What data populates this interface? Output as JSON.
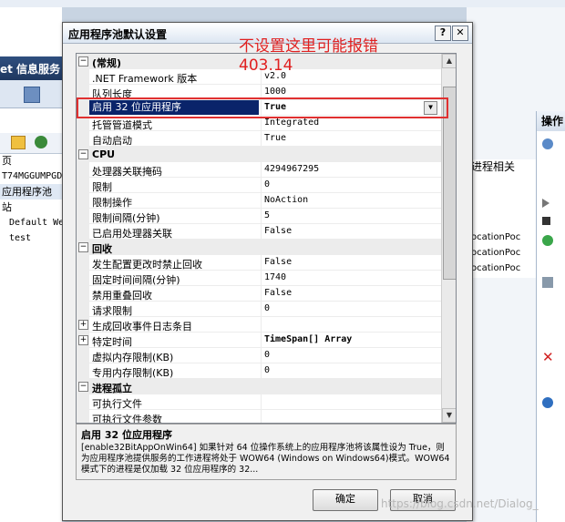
{
  "background": {
    "header_title": "et 信息服务",
    "tree": [
      "页",
      "T74MGGUMPGD",
      "应用程序池",
      "站",
      "Default We",
      "test"
    ],
    "right_middle": [
      "进程相关",
      "ocationPoc",
      "ocationPoc",
      "ocationPoc"
    ],
    "actions_header": "操作"
  },
  "dialog": {
    "title": "应用程序池默认设置",
    "help_button": "?",
    "close_button": "✕",
    "ok_label": "确定",
    "cancel_label": "取消"
  },
  "annotation": {
    "line1": "不设置这里可能报错",
    "line2": "403.14"
  },
  "properties": [
    {
      "type": "cat",
      "toggle": "⊟",
      "name": "(常规)"
    },
    {
      "name": ".NET Framework 版本",
      "value": "v2.0"
    },
    {
      "name": "队列长度",
      "value": "1000"
    },
    {
      "name": "启用 32 位应用程序",
      "value": "True",
      "selected": true
    },
    {
      "name": "托管管道模式",
      "value": "Integrated"
    },
    {
      "name": "自动启动",
      "value": "True"
    },
    {
      "type": "cat",
      "toggle": "⊟",
      "name": "CPU"
    },
    {
      "name": "处理器关联掩码",
      "value": "4294967295"
    },
    {
      "name": "限制",
      "value": "0"
    },
    {
      "name": "限制操作",
      "value": "NoAction"
    },
    {
      "name": "限制间隔(分钟)",
      "value": "5"
    },
    {
      "name": "已启用处理器关联",
      "value": "False"
    },
    {
      "type": "cat",
      "toggle": "⊟",
      "name": "回收"
    },
    {
      "name": "发生配置更改时禁止回收",
      "value": "False"
    },
    {
      "name": "固定时间间隔(分钟)",
      "value": "1740"
    },
    {
      "name": "禁用重叠回收",
      "value": "False"
    },
    {
      "name": "请求限制",
      "value": "0"
    },
    {
      "name": "生成回收事件日志条目",
      "value": "",
      "expand": true
    },
    {
      "name": "特定时间",
      "value": "TimeSpan[] Array",
      "expand": true,
      "bold": true
    },
    {
      "name": "虚拟内存限制(KB)",
      "value": "0"
    },
    {
      "name": "专用内存限制(KB)",
      "value": "0"
    },
    {
      "type": "cat",
      "toggle": "⊟",
      "name": "进程孤立"
    },
    {
      "name": "可执行文件",
      "value": ""
    },
    {
      "name": "可执行文件参数",
      "value": ""
    }
  ],
  "description": {
    "title": "启用 32 位应用程序",
    "text": "[enable32BitAppOnWin64] 如果针对 64 位操作系统上的应用程序池将该属性设为 True，则为应用程序池提供服务的工作进程将处于 WOW64 (Windows on Windows64)模式。WOW64 模式下的进程是仅加载 32 位应用程序的 32..."
  },
  "watermark": "https://blog.csdn.net/Dialog_"
}
